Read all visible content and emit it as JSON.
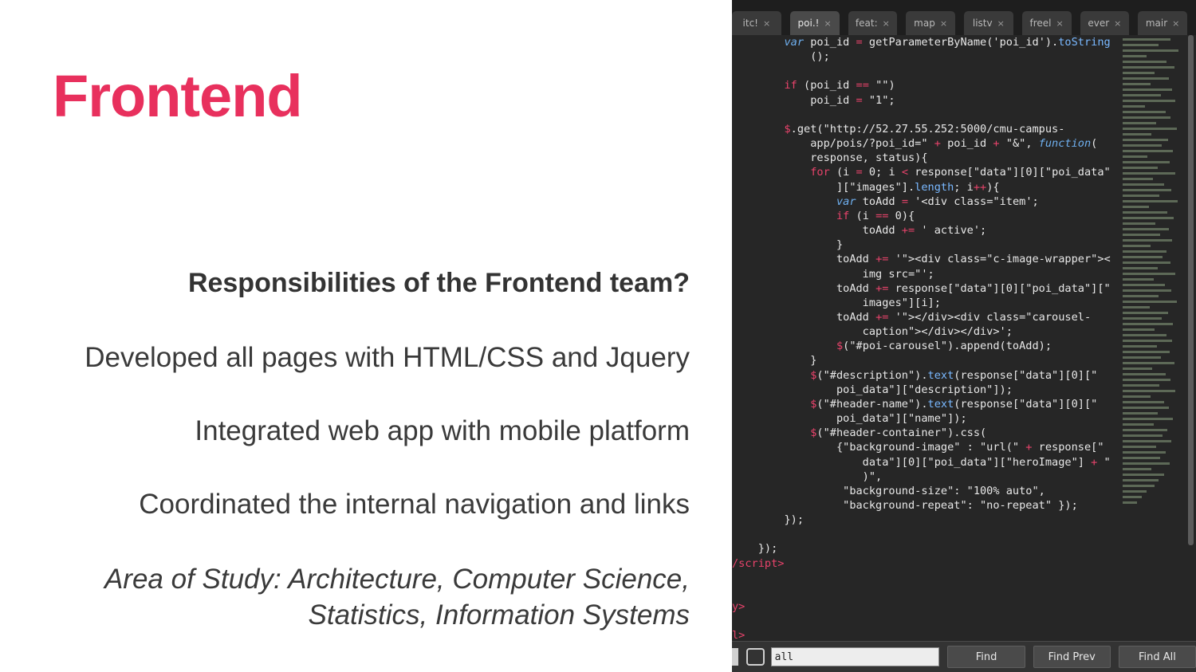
{
  "slide": {
    "title": "Frontend",
    "question": "Responsibilities of the Frontend team?",
    "items": [
      "Developed all pages with HTML/CSS and Jquery",
      "Integrated web app with mobile platform",
      "Coordinated the internal navigation and links"
    ],
    "area_line1": "Area of Study: Architecture, Computer Science,",
    "area_line2": "Statistics, Information Systems"
  },
  "editor": {
    "tabs": [
      {
        "label": "itc!",
        "active": false
      },
      {
        "label": "poi.!",
        "active": true
      },
      {
        "label": "feat:",
        "active": false
      },
      {
        "label": "map",
        "active": false
      },
      {
        "label": "listv",
        "active": false
      },
      {
        "label": "freel",
        "active": false
      },
      {
        "label": "ever",
        "active": false
      },
      {
        "label": "mair",
        "active": false
      }
    ],
    "tab_close": "×",
    "find": {
      "value": "all",
      "find_label": "Find",
      "find_prev_label": "Find Prev",
      "find_all_label": "Find All"
    },
    "colors": {
      "keyword": "#e8436b",
      "function": "#6fb0f0",
      "background": "#262626"
    }
  }
}
